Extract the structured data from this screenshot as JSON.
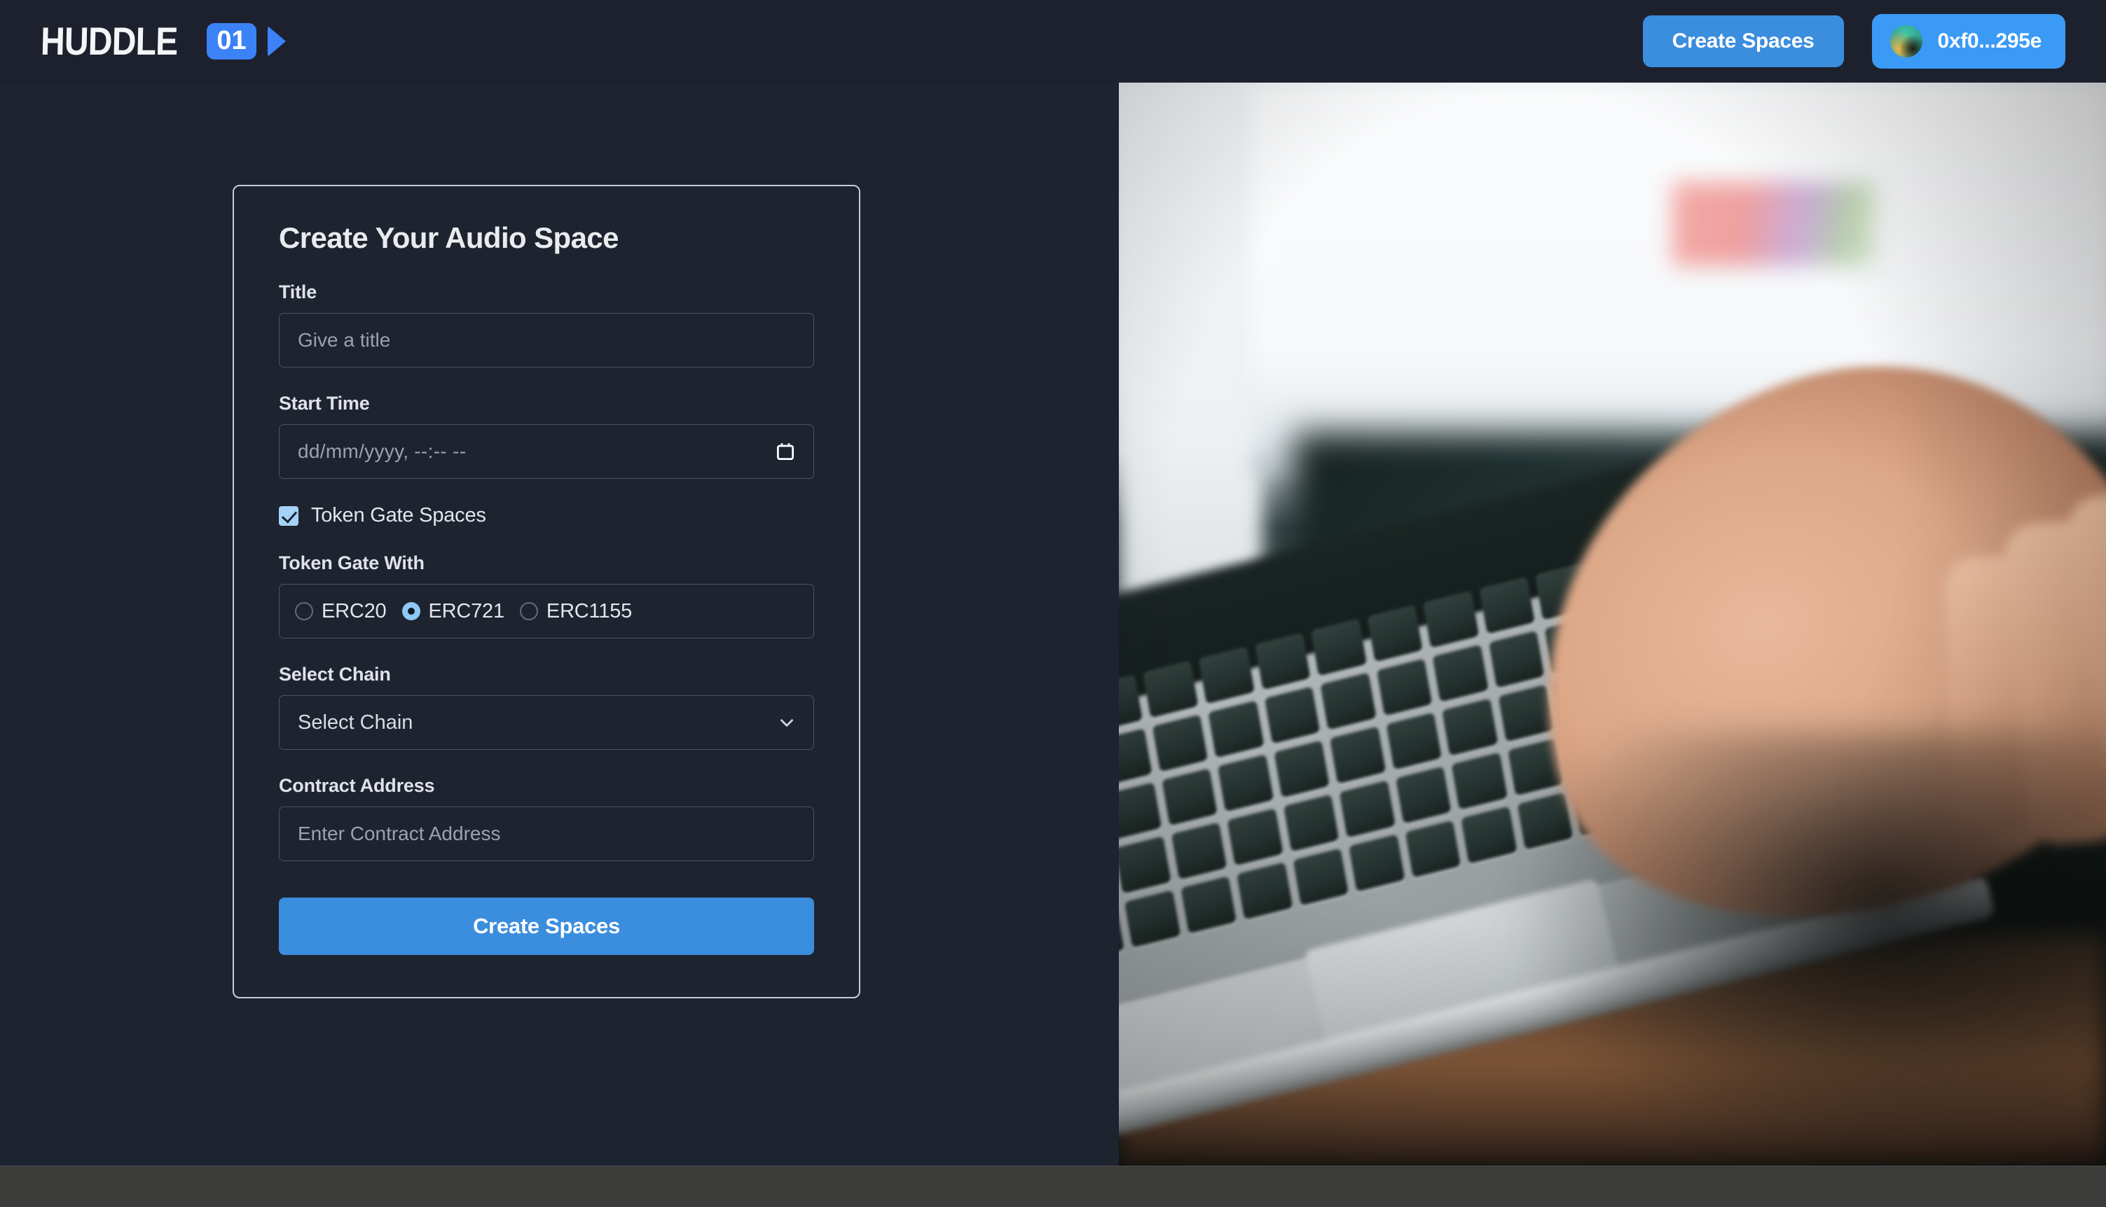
{
  "header": {
    "logo": {
      "word": "HUDDLE",
      "badge": "01",
      "camera_icon": "video-camera-icon"
    },
    "create_spaces_label": "Create Spaces",
    "account": {
      "address": "0xf0...295e",
      "avatar_icon": "wallet-avatar"
    }
  },
  "form": {
    "title": "Create Your Audio Space",
    "fields": {
      "title": {
        "label": "Title",
        "placeholder": "Give a title",
        "value": ""
      },
      "start_time": {
        "label": "Start Time",
        "placeholder": "dd/mm/yyyy, --:-- --",
        "value": "",
        "icon": "calendar-icon"
      },
      "token_gate_checkbox": {
        "label": "Token Gate Spaces",
        "checked": true
      },
      "token_gate_with": {
        "label": "Token Gate With",
        "options": [
          {
            "label": "ERC20",
            "selected": false
          },
          {
            "label": "ERC721",
            "selected": true
          },
          {
            "label": "ERC1155",
            "selected": false
          }
        ]
      },
      "select_chain": {
        "label": "Select Chain",
        "value": "Select Chain",
        "icon": "chevron-down-icon"
      },
      "contract_address": {
        "label": "Contract Address",
        "placeholder": "Enter Contract Address",
        "value": ""
      }
    },
    "submit_label": "Create Spaces"
  },
  "hero": {
    "alt": "person typing on a laptop keyboard"
  },
  "colors": {
    "page_bg": "#1e2330",
    "header_bg": "#1d212e",
    "accent_blue": "#3b8ddd",
    "account_blue": "#3b9af5",
    "badge_blue": "#3b82f6",
    "control_accent": "#8ec9f3",
    "card_border": "#c9ccd3",
    "input_border": "#4b5365",
    "text_primary": "#e9ebee",
    "text_muted": "#9ba2ae",
    "bottom_bar": "#3b3b39"
  }
}
